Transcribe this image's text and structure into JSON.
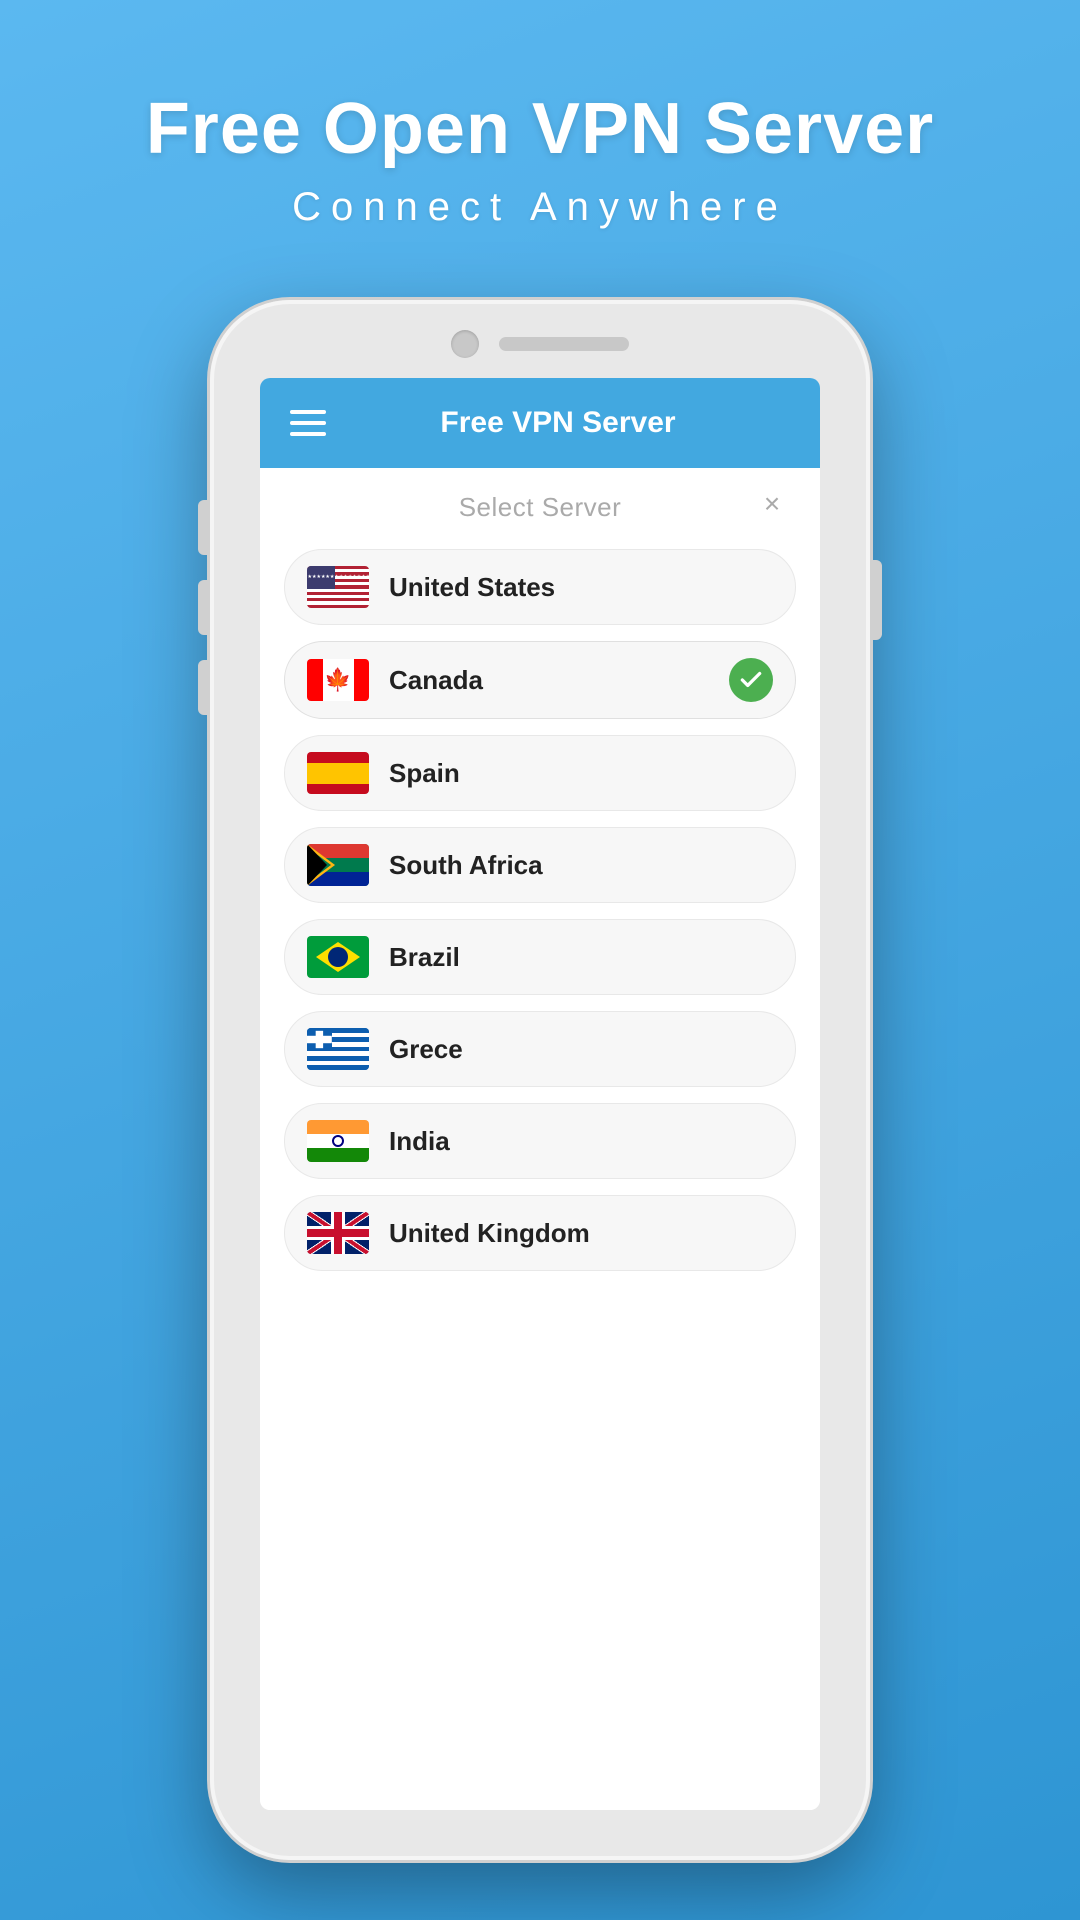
{
  "page": {
    "background_color": "#42a8e0",
    "header": {
      "title": "Free Open VPN Server",
      "subtitle": "Connect Anywhere"
    },
    "app": {
      "topbar": {
        "title": "Free VPN Server",
        "menu_icon": "hamburger-icon"
      },
      "dialog": {
        "title": "Select Server",
        "close_label": "×"
      },
      "servers": [
        {
          "id": "us",
          "name": "United States",
          "flag": "us",
          "selected": false
        },
        {
          "id": "ca",
          "name": "Canada",
          "flag": "ca",
          "selected": true
        },
        {
          "id": "es",
          "name": "Spain",
          "flag": "es",
          "selected": false
        },
        {
          "id": "za",
          "name": "South Africa",
          "flag": "za",
          "selected": false
        },
        {
          "id": "br",
          "name": "Brazil",
          "flag": "br",
          "selected": false
        },
        {
          "id": "gr",
          "name": "Grece",
          "flag": "gr",
          "selected": false
        },
        {
          "id": "in",
          "name": "India",
          "flag": "in",
          "selected": false
        },
        {
          "id": "gb",
          "name": "United Kingdom",
          "flag": "gb",
          "selected": false
        }
      ]
    }
  }
}
